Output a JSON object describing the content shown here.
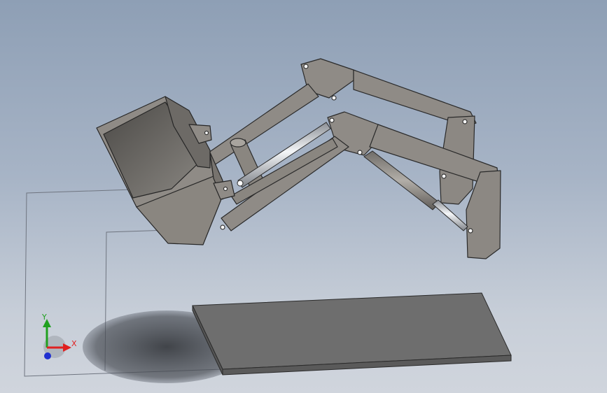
{
  "triad": {
    "x_label": "X",
    "y_label": "Y"
  },
  "colors": {
    "background_top": "#8e9fb5",
    "background_bottom": "#d0d5dd",
    "part_fill": "#8f8b86",
    "part_edge": "#2a2a2a",
    "plate_fill": "#6e6e6e",
    "cylinder_chrome": "#e8ecef",
    "axis_x": "#e02020",
    "axis_y": "#20a020",
    "axis_z": "#2030d0"
  },
  "icons": {
    "triad": "coordinate-triad-icon"
  }
}
